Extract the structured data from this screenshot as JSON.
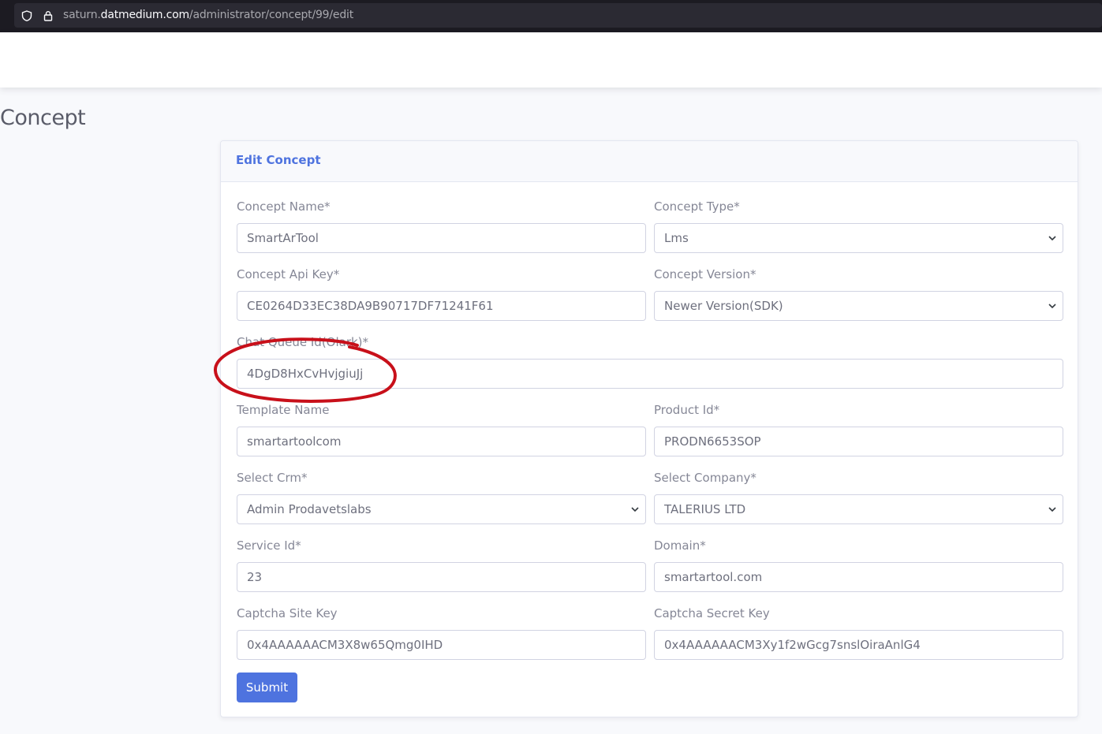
{
  "browser": {
    "url_prefix": "saturn.",
    "url_host": "datmedium.com",
    "url_path": "/administrator/concept/99/edit"
  },
  "page": {
    "title": "Concept"
  },
  "card": {
    "title": "Edit Concept",
    "submit_label": "Submit"
  },
  "fields": {
    "concept_name": {
      "label": "Concept Name*",
      "value": "SmartArTool"
    },
    "concept_type": {
      "label": "Concept Type*",
      "value": "Lms"
    },
    "concept_api_key": {
      "label": "Concept Api Key*",
      "value": "CE0264D33EC38DA9B90717DF71241F61"
    },
    "concept_version": {
      "label": "Concept Version*",
      "value": "Newer Version(SDK)"
    },
    "chat_queue_id": {
      "label": "Chat Queue Id(Olark)*",
      "value": "4DgD8HxCvHvjgiuJj"
    },
    "template_name": {
      "label": "Template Name",
      "value": "smartartoolcom"
    },
    "product_id": {
      "label": "Product Id*",
      "value": "PRODN6653SOP"
    },
    "select_crm": {
      "label": "Select Crm*",
      "value": "Admin Prodavetslabs"
    },
    "select_company": {
      "label": "Select Company*",
      "value": "TALERIUS LTD"
    },
    "service_id": {
      "label": "Service Id*",
      "value": "23"
    },
    "domain": {
      "label": "Domain*",
      "value": "smartartool.com"
    },
    "captcha_site_key": {
      "label": "Captcha Site Key",
      "value": "0x4AAAAAACM3X8w65Qmg0IHD"
    },
    "captcha_secret_key": {
      "label": "Captcha Secret Key",
      "value": "0x4AAAAAACM3Xy1f2wGcg7snslOiraAnlG4"
    }
  },
  "colors": {
    "primary": "#4e73df",
    "annotation": "#c8101a"
  },
  "icons": {
    "shield": "shield-icon",
    "lock": "lock-icon",
    "select_arrow": "chevron-down-icon"
  }
}
